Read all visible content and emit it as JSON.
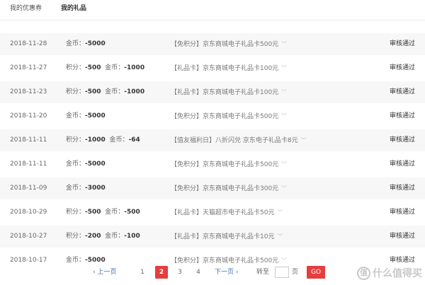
{
  "tabs": [
    {
      "label": "我的优惠券"
    },
    {
      "label": "我的礼品"
    }
  ],
  "rows": [
    {
      "date": "2018-11-28",
      "points": "",
      "coins": "-5000",
      "gift": "【免积分】京东商城电子礼品卡500元",
      "status": "审核通过"
    },
    {
      "date": "2018-11-27",
      "points": "-500",
      "coins": "-1000",
      "gift": "【礼品卡】京东商城电子礼品卡100元",
      "status": "审核通过"
    },
    {
      "date": "2018-11-23",
      "points": "-500",
      "coins": "-1000",
      "gift": "【礼品卡】京东商城电子礼品卡100元",
      "status": "审核通过"
    },
    {
      "date": "2018-11-20",
      "points": "",
      "coins": "-5000",
      "gift": "【免积分】京东商城电子礼品卡500元",
      "status": "审核通过"
    },
    {
      "date": "2018-11-11",
      "points": "-1000",
      "coins": "-64",
      "gift": "【值友福利日】八折闪兑 京东电子礼品卡8元",
      "status": "审核通过"
    },
    {
      "date": "2018-11-11",
      "points": "",
      "coins": "-5000",
      "gift": "【免积分】京东商城电子礼品卡500元",
      "status": "审核通过"
    },
    {
      "date": "2018-11-09",
      "points": "",
      "coins": "-3000",
      "gift": "【免积分】京东商城电子礼品卡300元",
      "status": "审核通过"
    },
    {
      "date": "2018-10-29",
      "points": "-500",
      "coins": "-500",
      "gift": "【礼品卡】天猫超市电子礼品卡50元",
      "status": "审核通过"
    },
    {
      "date": "2018-10-27",
      "points": "-200",
      "coins": "-100",
      "gift": "【礼品卡】京东商城电子礼品卡10元",
      "status": "审核通过"
    },
    {
      "date": "2018-10-17",
      "points": "",
      "coins": "-5000",
      "gift": "【免积分】京东商城电子礼品卡500元",
      "status": "审核通过"
    }
  ],
  "labels": {
    "points": "积分：",
    "coins": "金币：",
    "chevron": "﹀"
  },
  "pager": {
    "prev": "‹ 上一页",
    "pages": [
      "1",
      "2",
      "3",
      "4"
    ],
    "current": "2",
    "next": "下一页 ›",
    "goto": "转至",
    "page_unit": "页",
    "go": "GO",
    "input_value": ""
  },
  "watermark": {
    "icon_char": "值",
    "text": "什么值得买"
  }
}
